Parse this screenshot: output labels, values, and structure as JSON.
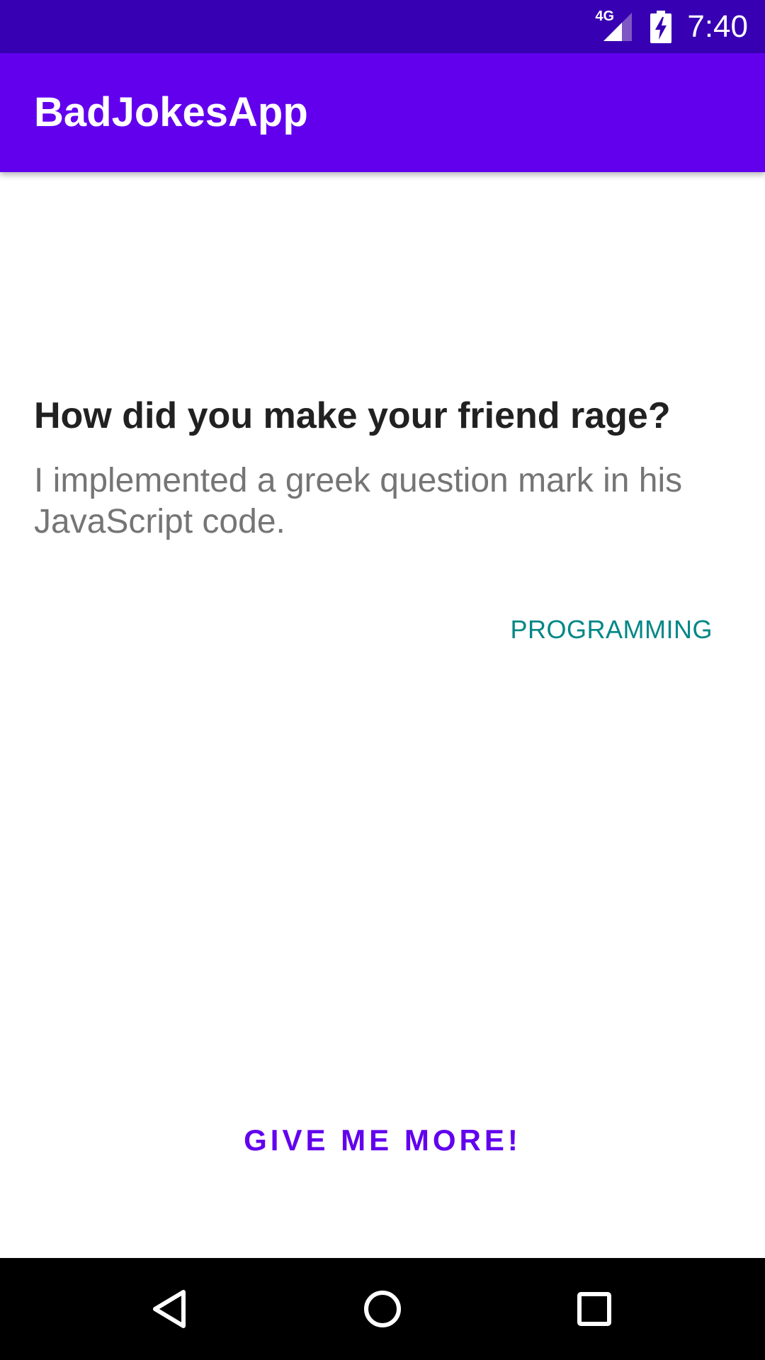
{
  "status_bar": {
    "network_type": "4G",
    "time": "7:40",
    "icons": [
      "signal-icon",
      "battery-charging-icon"
    ]
  },
  "app_bar": {
    "title": "BadJokesApp"
  },
  "joke": {
    "setup": "How did you make your friend rage?",
    "delivery": "I implemented a greek question mark in his JavaScript code.",
    "category": "PROGRAMMING"
  },
  "actions": {
    "more_label": "GIVE ME MORE!"
  },
  "nav_bar": {
    "icons": [
      "back-icon",
      "home-icon",
      "recents-icon"
    ]
  },
  "colors": {
    "status_bar": "#3700b3",
    "primary": "#6200ee",
    "category_accent": "#018786",
    "setup_text": "#212121",
    "delivery_text": "#757575"
  }
}
